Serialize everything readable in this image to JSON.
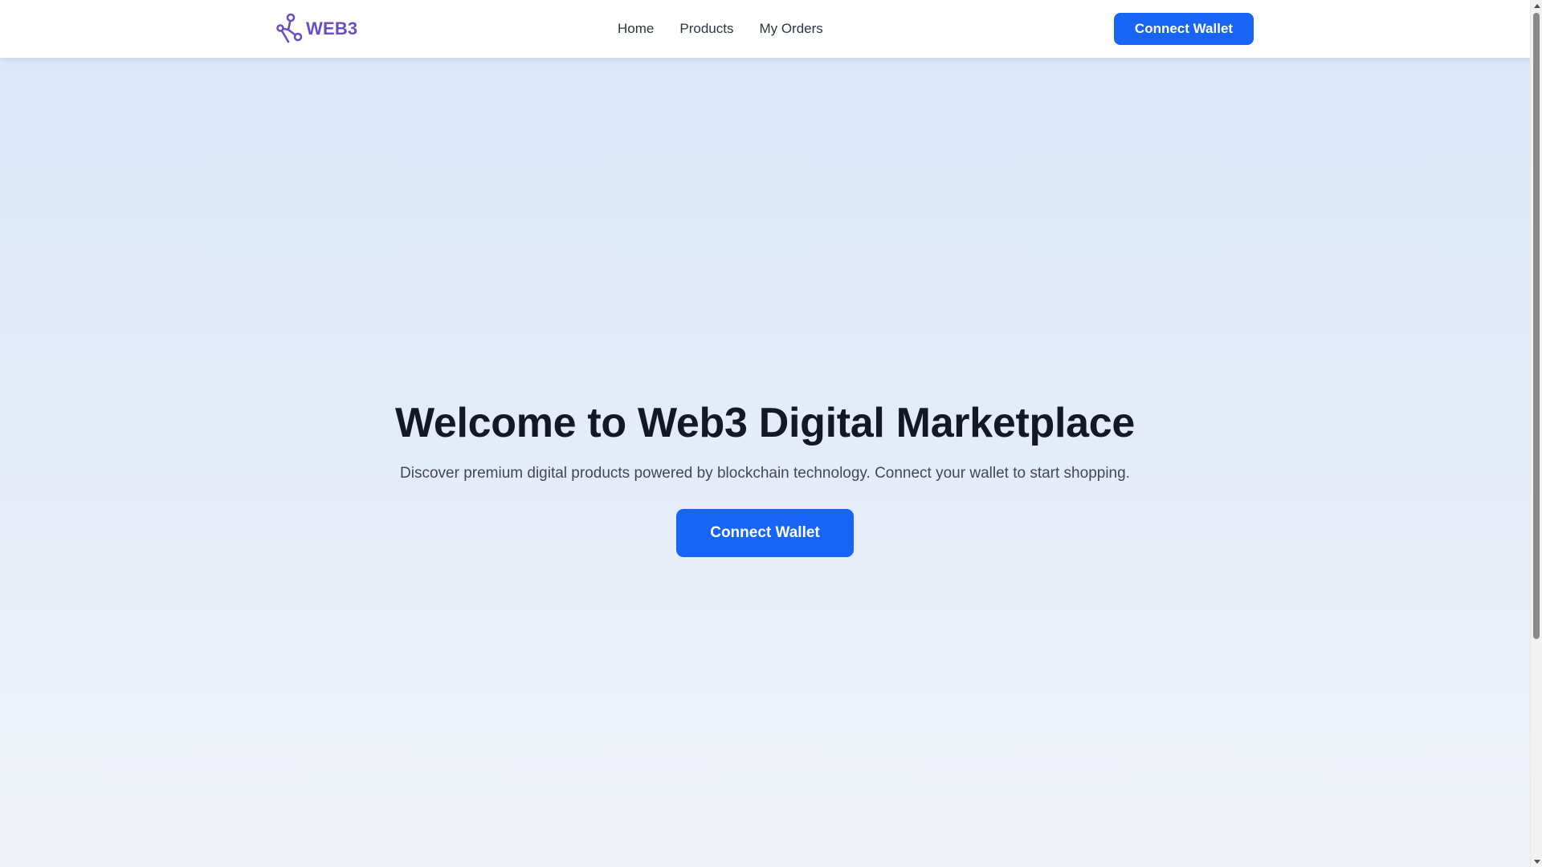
{
  "header": {
    "logo_text": "WEB3",
    "logo_icon": "network-nodes-icon",
    "nav_links": [
      "Home",
      "Products",
      "My Orders"
    ],
    "connect_wallet_label": "Connect Wallet"
  },
  "hero": {
    "title": "Welcome to Web3 Digital Marketplace",
    "subtitle": "Discover premium digital products powered by blockchain technology. Connect your wallet to start shopping.",
    "cta_label": "Connect Wallet"
  },
  "colors": {
    "brand": "#6a4fc4",
    "accent": "#1764f5",
    "title": "#121826",
    "text": "#404756",
    "background_top": "#dbe8fb",
    "background_bottom": "#f1f3f9"
  },
  "scrollbar": {
    "position_fraction": 0
  }
}
